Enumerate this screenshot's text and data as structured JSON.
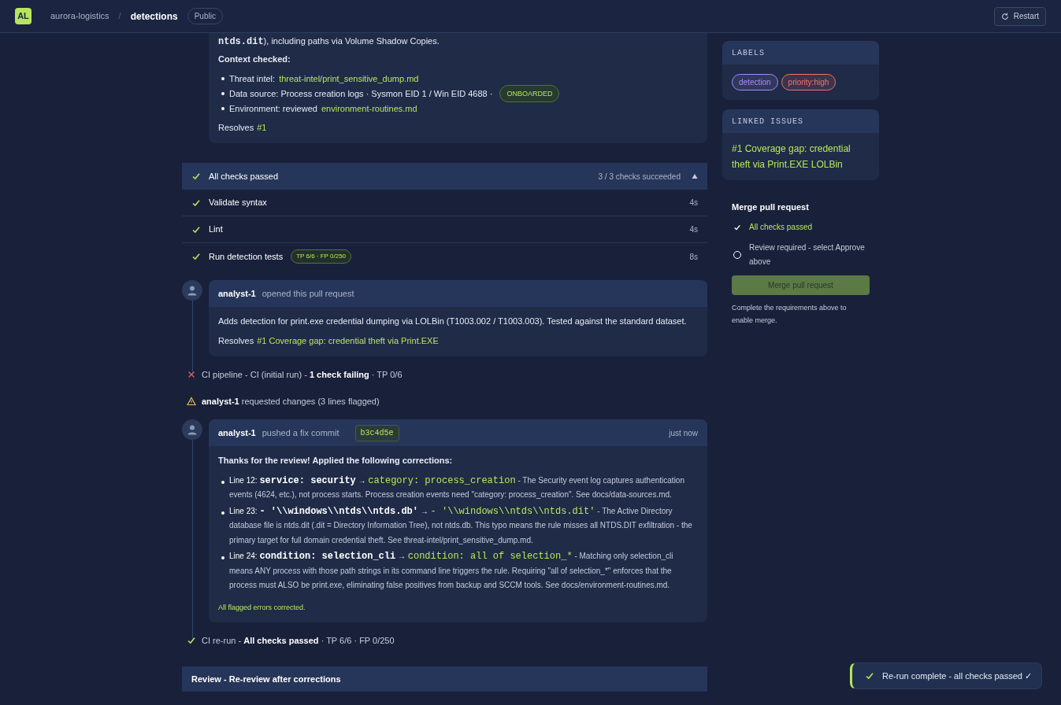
{
  "header": {
    "logo": "AL",
    "org": "aurora-logistics",
    "separator": "/",
    "repo": "detections",
    "visibility": "Public",
    "restart": "Restart"
  },
  "description": {
    "lead_code": "ntds.dit",
    "lead_text": "), including paths via Volume Shadow Copies.",
    "context_title": "Context checked:",
    "context_items": [
      {
        "text": "Threat intel: ",
        "link": "threat-intel/print_sensitive_dump.md"
      },
      {
        "text": "Data source: Process creation logs · Sysmon EID 1 / Win EID 4688 · ",
        "badge": "ONBOARDED"
      },
      {
        "text": "Environment: reviewed ",
        "link": "environment-routines.md"
      }
    ],
    "resolves_label": "Resolves",
    "resolves_link": "#1"
  },
  "checks": {
    "title": "All checks passed",
    "summary": "3 / 3 checks succeeded",
    "expanded": true,
    "items": [
      {
        "name": "Validate syntax",
        "duration": "4s",
        "passed": true
      },
      {
        "name": "Lint",
        "duration": "4s",
        "passed": true
      },
      {
        "name": "Run detection tests",
        "badge": "TP 6/6 · FP 0/250",
        "duration": "8s",
        "passed": true
      }
    ]
  },
  "timeline": [
    {
      "kind": "comment",
      "author": "analyst-1",
      "action": "opened this pull request",
      "paragraphs": [
        "Adds detection for print.exe credential dumping via LOLBin (T1003.002 / T1003.003). Tested against the standard dataset."
      ],
      "resolves_label": "Resolves",
      "resolves_link": "#1 Coverage gap: credential theft via Print.EXE"
    },
    {
      "kind": "failure",
      "text": "CI pipeline - CI (initial run) - **1 check failing** · TP 0/6"
    },
    {
      "kind": "warning",
      "text": "**analyst-1** requested changes (3 lines flagged)"
    },
    {
      "kind": "comment",
      "author": "analyst-1",
      "action": "pushed a fix commit",
      "commit": "b3c4d5e",
      "time": "just now",
      "intro": "Thanks for the review! Applied the following corrections:",
      "corrections": [
        {
          "line": "Line 12:",
          "old": "service: security",
          "arrow": "→",
          "new": "category: process_creation",
          "note": "- The Security event log captures authentication events (4624, etc.), not process starts. Process creation events need \"category: process_creation\". See docs/data-sources.md."
        },
        {
          "line": "Line 23:",
          "old": "- '\\\\windows\\\\ntds\\\\ntds.db'",
          "arrow": "→",
          "new": "- '\\\\windows\\\\ntds\\\\ntds.dit'",
          "note": "- The Active Directory database file is ntds.dit (.dit = Directory Information Tree), not ntds.db. This typo means the rule misses all NTDS.DIT exfiltration - the primary target for full domain credential theft. See threat-intel/print_sensitive_dump.md."
        },
        {
          "line": "Line 24:",
          "old": "condition: selection_cli",
          "arrow": "→",
          "new": "condition: all of selection_*",
          "note": "- Matching only selection_cli means ANY process with those path strings in its command line triggers the rule. Requiring \"all of selection_*\" enforces that the process must ALSO be print.exe, eliminating false positives from backup and SCCM tools. See docs/environment-routines.md."
        }
      ],
      "footer": "All flagged errors corrected."
    },
    {
      "kind": "success",
      "text": "CI re-run - **All checks passed** · TP 6/6 · FP 0/250"
    }
  ],
  "review": {
    "title": "Review - Re-review after corrections"
  },
  "sidebar": {
    "labels_title": "LABELS",
    "labels": [
      {
        "text": "detection",
        "color": "#a78bfa"
      },
      {
        "text": "priority:high",
        "color": "#f87171"
      }
    ],
    "linked_title": "LINKED ISSUES",
    "linked_issue": "#1 Coverage gap: credential theft via Print.EXE LOLBin",
    "merge": {
      "title": "Merge pull request",
      "requirements": [
        {
          "text": "All checks passed",
          "met": true
        },
        {
          "text": "Review required - select Approve above",
          "met": false
        }
      ],
      "button": "Merge pull request",
      "disabled": true,
      "note": "Complete the requirements above to enable merge."
    }
  },
  "toast": {
    "text": "Re-run complete - all checks passed ✓"
  }
}
